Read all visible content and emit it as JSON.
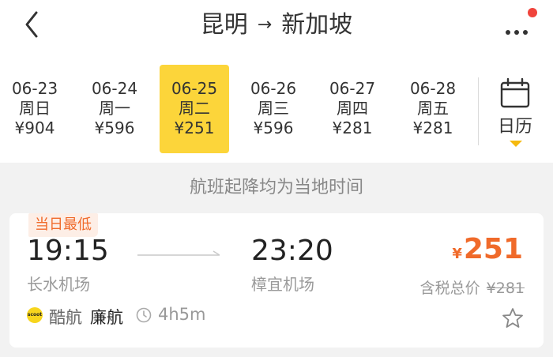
{
  "header": {
    "from": "昆明",
    "arrow": "→",
    "to": "新加坡",
    "back_icon": "chevron-left-icon",
    "more_icon": "more-horizontal-icon"
  },
  "dates": [
    {
      "date": "06-23",
      "weekday": "周日",
      "price": "¥904",
      "selected": false
    },
    {
      "date": "06-24",
      "weekday": "周一",
      "price": "¥596",
      "selected": false
    },
    {
      "date": "06-25",
      "weekday": "周二",
      "price": "¥251",
      "selected": true
    },
    {
      "date": "06-26",
      "weekday": "周三",
      "price": "¥596",
      "selected": false
    },
    {
      "date": "06-27",
      "weekday": "周四",
      "price": "¥281",
      "selected": false
    },
    {
      "date": "06-28",
      "weekday": "周五",
      "price": "¥281",
      "selected": false
    }
  ],
  "calendar": {
    "label": "日历",
    "icon": "calendar-icon"
  },
  "notice": "航班起降均为当地时间",
  "flight": {
    "badge": "当日最低",
    "dep_time": "19:15",
    "dep_airport": "长水机场",
    "arr_time": "23:20",
    "arr_airport": "樟宜机场",
    "currency": "¥",
    "price": "251",
    "tax_label": "含税总价",
    "original_price": "¥281",
    "airline_logo_text": "scoot",
    "airline": "酷航",
    "airline_tag": "廉航",
    "duration": "4h5m"
  },
  "colors": {
    "accent": "#fcd53a",
    "price": "#f06a2a",
    "badge_bg": "#fdeee6",
    "notification": "#f0443c"
  }
}
